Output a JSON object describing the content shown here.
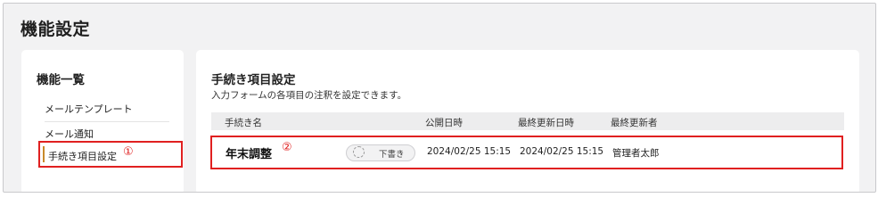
{
  "page": {
    "title": "機能設定"
  },
  "sidebar": {
    "title": "機能一覧",
    "items": [
      {
        "label": "メールテンプレート"
      },
      {
        "label": "メール通知"
      },
      {
        "label": "手続き項目設定",
        "marker": "①"
      }
    ]
  },
  "main": {
    "title": "手続き項目設定",
    "description": "入力フォームの各項目の注釈を設定できます。",
    "table": {
      "columns": [
        "手続き名",
        "公開日時",
        "最終更新日時",
        "最終更新者"
      ],
      "rows": [
        {
          "name": "年末調整",
          "marker": "②",
          "status": "下書き",
          "published_at": "2024/02/25 15:15",
          "updated_at": "2024/02/25 15:15",
          "updated_by": "管理者太郎"
        }
      ]
    }
  },
  "colors": {
    "highlight": "#e02020",
    "background": "#f2f2f3",
    "active_bar": "#c98a2b"
  }
}
